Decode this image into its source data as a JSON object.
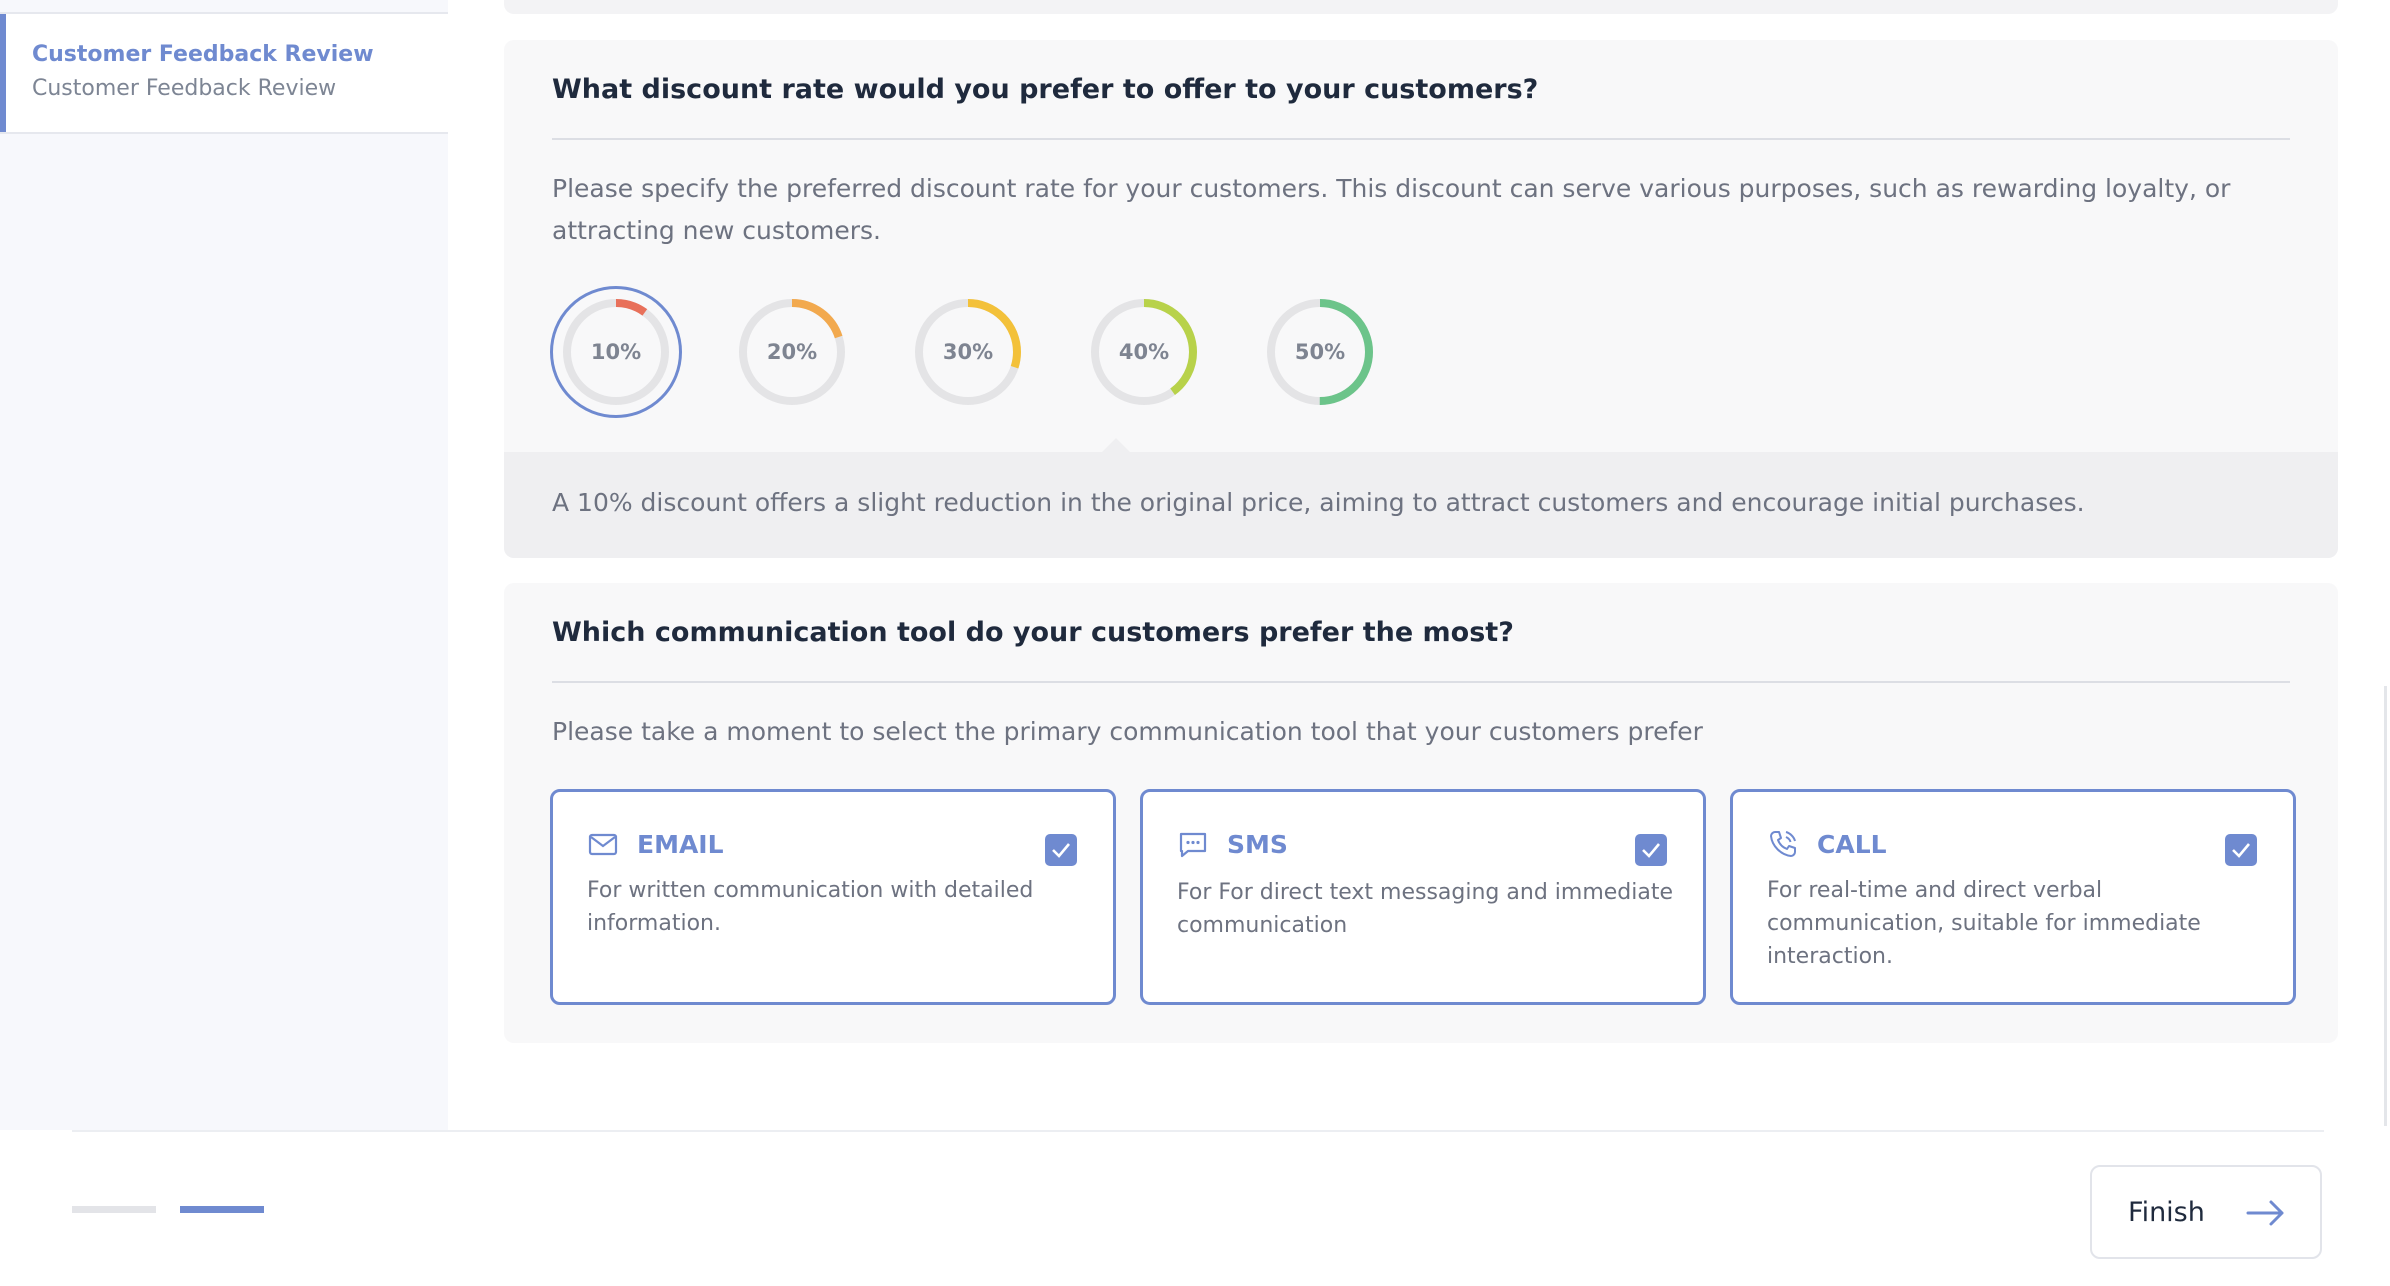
{
  "sidebar": {
    "items": [
      {
        "title": "Customer Feedback Review",
        "subtitle": "Customer Feedback Review"
      }
    ]
  },
  "discount_question": {
    "title": "What discount rate would you prefer to offer to your customers?",
    "description": "Please specify the preferred discount rate for your customers. This discount can serve various purposes, such as rewarding loyalty, or attracting new customers.",
    "options": [
      {
        "label": "10%",
        "value": 10,
        "color": "#e8705a",
        "selected": true
      },
      {
        "label": "20%",
        "value": 20,
        "color": "#f2a94e",
        "selected": false
      },
      {
        "label": "30%",
        "value": 30,
        "color": "#f3c13a",
        "selected": false
      },
      {
        "label": "40%",
        "value": 40,
        "color": "#b8d24a",
        "selected": false
      },
      {
        "label": "50%",
        "value": 50,
        "color": "#6cc48a",
        "selected": false
      }
    ],
    "info": "A 10% discount offers a slight reduction in the original price, aiming to attract customers and encourage initial purchases."
  },
  "communication_question": {
    "title": "Which communication tool do your customers prefer the most?",
    "description": "Please take a moment to select the primary communication tool that your customers prefer",
    "tools": [
      {
        "name": "EMAIL",
        "icon": "envelope-icon",
        "description": "For written communication with detailed information.",
        "checked": true
      },
      {
        "name": "SMS",
        "icon": "chat-icon",
        "description": "For For direct text messaging and immediate communication",
        "checked": true
      },
      {
        "name": "CALL",
        "icon": "phone-icon",
        "description": "For real-time and direct verbal communication, suitable for immediate interaction.",
        "checked": true
      }
    ]
  },
  "footer": {
    "finish_label": "Finish",
    "steps_total": 2,
    "current_step": 2
  },
  "colors": {
    "accent": "#6f8ad0"
  }
}
